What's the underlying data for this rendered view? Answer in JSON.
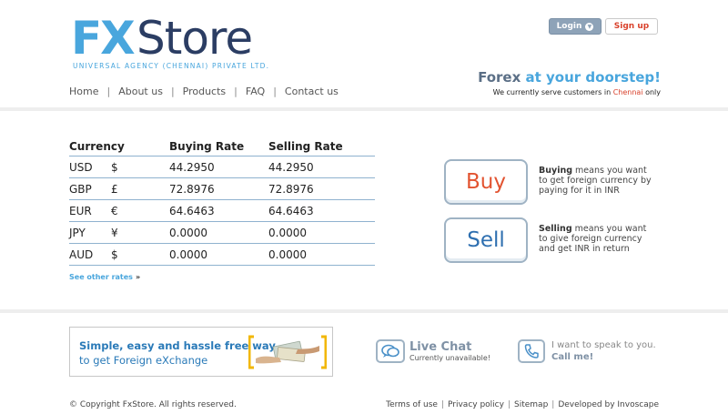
{
  "brand": {
    "logo_fx": "FX",
    "logo_store": "Store",
    "logo_tag": "UNIVERSAL AGENCY (CHENNAI) PRIVATE LTD."
  },
  "nav": {
    "items": [
      "Home",
      "About us",
      "Products",
      "FAQ",
      "Contact us"
    ],
    "separator": "|"
  },
  "auth": {
    "login_label": "Login",
    "signup_label": "Sign up"
  },
  "tagline": {
    "main_prefix": "Forex",
    "main_accent": " at your doorstep!",
    "sub_prefix": "We currently serve customers in ",
    "sub_city": "Chennai",
    "sub_suffix": " only"
  },
  "rates": {
    "headers": [
      "Currency",
      "Buying Rate",
      "Selling Rate"
    ],
    "rows": [
      {
        "code": "USD",
        "symbol": "$",
        "buy": "44.2950",
        "sell": "44.2950"
      },
      {
        "code": "GBP",
        "symbol": "£",
        "buy": "72.8976",
        "sell": "72.8976"
      },
      {
        "code": "EUR",
        "symbol": "€",
        "buy": "64.6463",
        "sell": "64.6463"
      },
      {
        "code": "JPY",
        "symbol": "¥",
        "buy": "0.0000",
        "sell": "0.0000"
      },
      {
        "code": "AUD",
        "symbol": "$",
        "buy": "0.0000",
        "sell": "0.0000"
      }
    ],
    "see_more": "See other rates",
    "see_more_arrows": "»"
  },
  "actions": {
    "buy_label": "Buy",
    "buy_desc_bold": "Buying",
    "buy_desc": " means you want to get foreign currency by paying for it in INR",
    "sell_label": "Sell",
    "sell_desc_bold": "Selling",
    "sell_desc": " means you want to give foreign currency and get INR in return"
  },
  "promo": {
    "line1": "Simple, easy and hassle free way",
    "line2": "to get Foreign eXchange"
  },
  "contact": {
    "chat_title": "Live Chat",
    "chat_status": "Currently unavailable!",
    "call_line1": "I want to speak to you.",
    "call_line2": "Call me!"
  },
  "footer": {
    "copyright": "© Copyright FxStore. All rights reserved.",
    "links": [
      "Terms of use",
      "Privacy policy",
      "Sitemap",
      "Developed by Invoscape"
    ],
    "separator": "|"
  },
  "colors": {
    "brand_blue": "#49a6dd",
    "brand_navy": "#2b3d63",
    "accent_red": "#d9412b",
    "buy_color": "#e25330",
    "sell_color": "#2e6fb0"
  }
}
